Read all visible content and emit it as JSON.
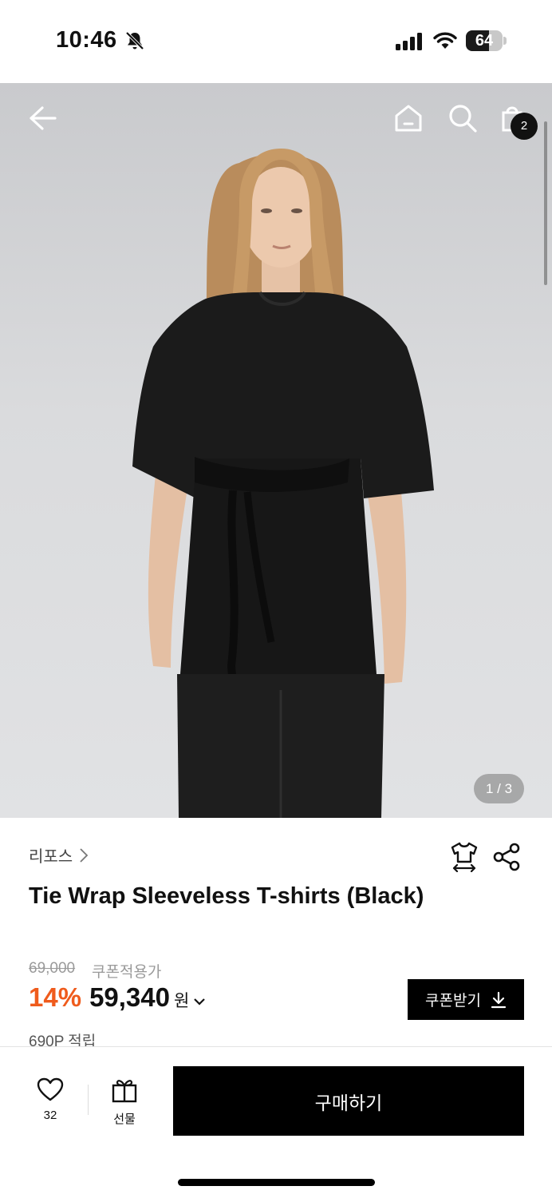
{
  "status_bar": {
    "time": "10:46",
    "battery_level": "64",
    "battery_fraction": 0.64,
    "icons": [
      "bell-off-icon",
      "signal-icon",
      "wifi-icon",
      "battery-icon"
    ]
  },
  "hero": {
    "page_counter": "1 / 3",
    "cart_count": "2",
    "icons": [
      "back-arrow-icon",
      "home-icon",
      "search-icon",
      "shopping-bag-icon"
    ]
  },
  "product": {
    "brand": "리포스",
    "title": "Tie Wrap Sleeveless T-shirts (Black)",
    "original_price": "69,000",
    "coupon_price_label": "쿠폰적용가",
    "discount": "14%",
    "sale_price": "59,340",
    "currency": "원",
    "points": "690P 적립",
    "coupon_button": "쿠폰받기",
    "icons": [
      "size-guide-icon",
      "share-icon",
      "chevron-right-icon",
      "chevron-down-icon",
      "download-icon"
    ]
  },
  "bottom_bar": {
    "like_count": "32",
    "gift_label": "선물",
    "buy_button": "구매하기",
    "icons": [
      "heart-icon",
      "gift-icon"
    ]
  },
  "colors": {
    "accent_discount": "#ef5b1c",
    "primary": "#000000",
    "background": "#ffffff"
  }
}
